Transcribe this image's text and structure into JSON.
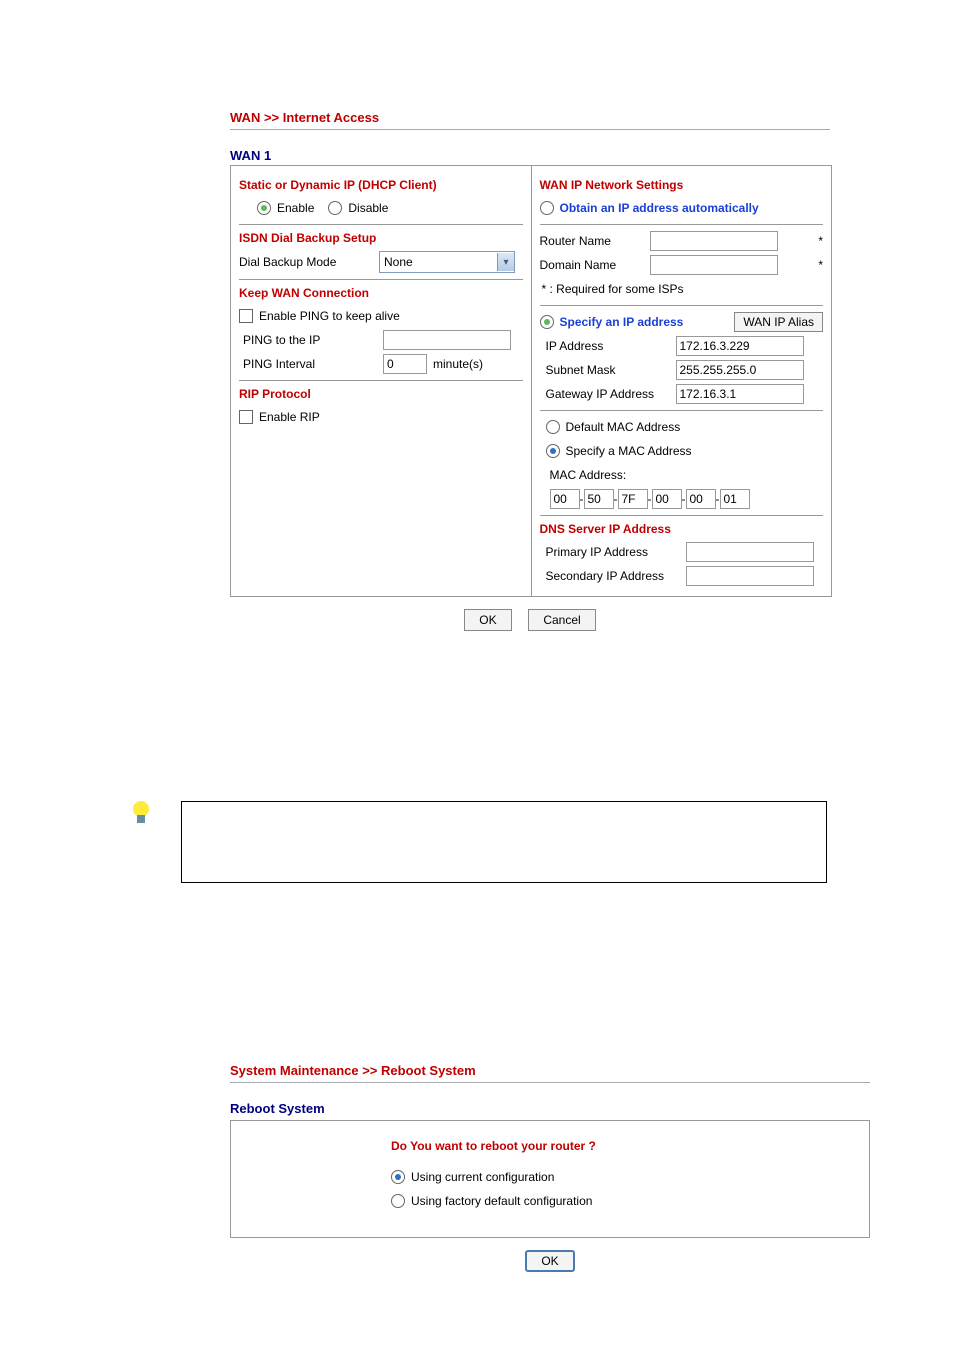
{
  "wan": {
    "breadcrumb": "WAN >> Internet Access",
    "title": "WAN 1",
    "left": {
      "static_dhcp_h": "Static or Dynamic IP (DHCP Client)",
      "enable_label": "Enable",
      "disable_label": "Disable",
      "isdn_h": "ISDN Dial Backup Setup",
      "dial_backup_mode_label": "Dial Backup Mode",
      "dial_backup_mode_value": "None",
      "keep_wan_h": "Keep WAN Connection",
      "enable_ping_label": "Enable PING to keep alive",
      "ping_to_ip_label": "PING to the IP",
      "ping_to_ip_value": "",
      "ping_interval_label": "PING Interval",
      "ping_interval_value": "0",
      "ping_interval_unit": "minute(s)",
      "rip_h": "RIP Protocol",
      "enable_rip_label": "Enable RIP"
    },
    "right": {
      "wan_ip_h": "WAN IP Network Settings",
      "obtain_auto_label": "Obtain an IP address automatically",
      "router_name_label": "Router Name",
      "router_name_value": "",
      "star1": "*",
      "domain_name_label": "Domain Name",
      "domain_name_value": "",
      "star2": "*",
      "required_note": "* : Required for some ISPs",
      "specify_ip_label": "Specify an IP address",
      "wan_ip_alias_btn": "WAN IP Alias",
      "ip_address_label": "IP Address",
      "ip_address_value": "172.16.3.229",
      "subnet_mask_label": "Subnet Mask",
      "subnet_mask_value": "255.255.255.0",
      "gateway_label": "Gateway IP Address",
      "gateway_value": "172.16.3.1",
      "default_mac_label": "Default MAC Address",
      "specify_mac_label": "Specify a MAC Address",
      "mac_address_label": "MAC Address:",
      "mac": [
        "00",
        "50",
        "7F",
        "00",
        "00",
        "01"
      ],
      "dns_h": "DNS Server IP Address",
      "primary_ip_label": "Primary IP Address",
      "primary_ip_value": "",
      "secondary_ip_label": "Secondary IP Address",
      "secondary_ip_value": ""
    },
    "ok_btn": "OK",
    "cancel_btn": "Cancel"
  },
  "reboot": {
    "breadcrumb": "System Maintenance >> Reboot System",
    "title": "Reboot System",
    "question": "Do You want to reboot your router ?",
    "opt_current": "Using current configuration",
    "opt_factory": "Using factory default configuration",
    "ok_btn": "OK"
  }
}
